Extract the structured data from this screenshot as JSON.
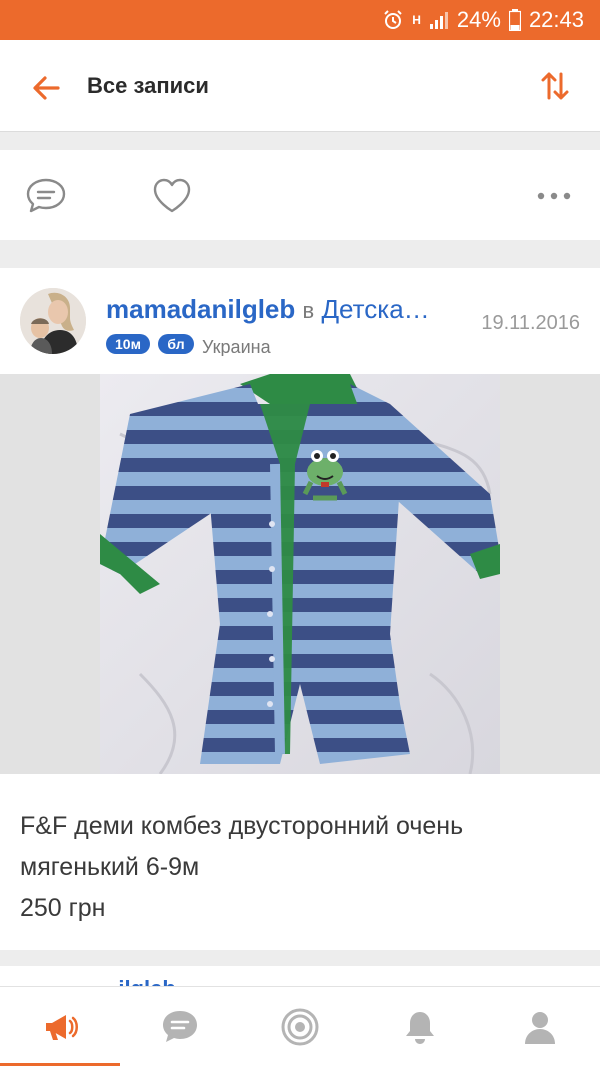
{
  "status_bar": {
    "battery": "24%",
    "time": "22:43",
    "network": "H"
  },
  "header": {
    "title": "Все записи"
  },
  "post": {
    "author": "mamadanilgleb",
    "in_word": "в",
    "group": "Детска…",
    "date": "19.11.2016",
    "badges": [
      "10м",
      "бл"
    ],
    "location": "Украина",
    "text_lines": [
      "F&F деми комбез двусторонний очень",
      "мягенький 6-9м",
      "250 грн"
    ]
  },
  "next_post": {
    "author_peek": "...ilgleb"
  },
  "colors": {
    "accent": "#ec6a2c",
    "link": "#2a67c6"
  },
  "icons": {
    "back": "arrow-left-icon",
    "sort": "sort-arrows-icon",
    "comment": "comment-icon",
    "like": "heart-icon",
    "more": "more-dots-icon",
    "nav": [
      "megaphone-icon",
      "chat-icon",
      "target-icon",
      "bell-icon",
      "profile-icon"
    ]
  }
}
